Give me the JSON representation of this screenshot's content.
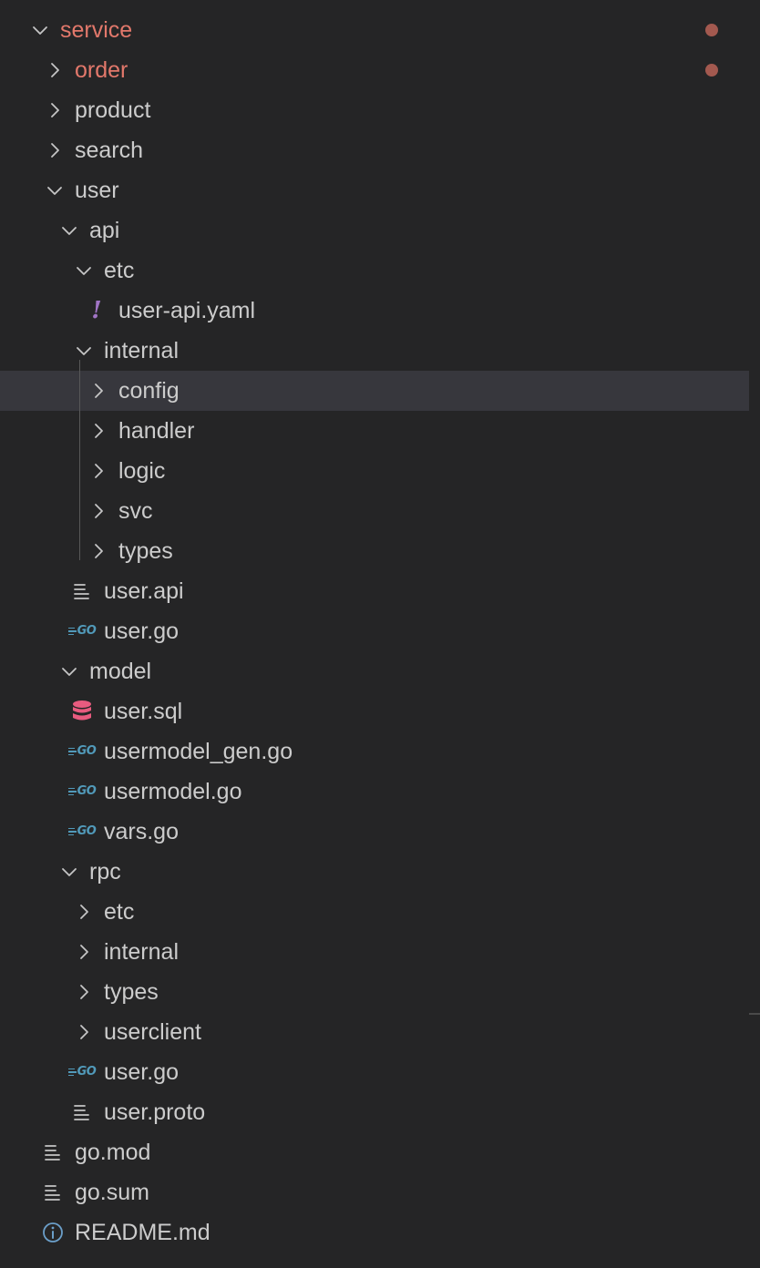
{
  "colors": {
    "background": "#252526",
    "text": "#cccccc",
    "modified": "#e2786b",
    "modified_dot": "#a3594f",
    "selection": "#37373d",
    "go_icon": "#519aba",
    "yaml_icon": "#a074c4",
    "sql_icon": "#e85b7f"
  },
  "explorer": {
    "items": [
      {
        "label": "service",
        "kind": "folder",
        "expanded": true,
        "depth": 0,
        "modified": true,
        "badge": true
      },
      {
        "label": "order",
        "kind": "folder",
        "expanded": false,
        "depth": 1,
        "modified": true,
        "badge": true
      },
      {
        "label": "product",
        "kind": "folder",
        "expanded": false,
        "depth": 1
      },
      {
        "label": "search",
        "kind": "folder",
        "expanded": false,
        "depth": 1
      },
      {
        "label": "user",
        "kind": "folder",
        "expanded": true,
        "depth": 1
      },
      {
        "label": "api",
        "kind": "folder",
        "expanded": true,
        "depth": 2
      },
      {
        "label": "etc",
        "kind": "folder",
        "expanded": true,
        "depth": 3
      },
      {
        "label": "user-api.yaml",
        "kind": "file",
        "icon": "yaml-icon",
        "depth": 4
      },
      {
        "label": "internal",
        "kind": "folder",
        "expanded": true,
        "depth": 3
      },
      {
        "label": "config",
        "kind": "folder",
        "expanded": false,
        "depth": 4,
        "selected": true
      },
      {
        "label": "handler",
        "kind": "folder",
        "expanded": false,
        "depth": 4
      },
      {
        "label": "logic",
        "kind": "folder",
        "expanded": false,
        "depth": 4
      },
      {
        "label": "svc",
        "kind": "folder",
        "expanded": false,
        "depth": 4
      },
      {
        "label": "types",
        "kind": "folder",
        "expanded": false,
        "depth": 4
      },
      {
        "label": "user.api",
        "kind": "file",
        "icon": "text-file-icon",
        "depth": 3
      },
      {
        "label": "user.go",
        "kind": "file",
        "icon": "go-icon",
        "depth": 3
      },
      {
        "label": "model",
        "kind": "folder",
        "expanded": true,
        "depth": 2
      },
      {
        "label": "user.sql",
        "kind": "file",
        "icon": "database-icon",
        "depth": 3
      },
      {
        "label": "usermodel_gen.go",
        "kind": "file",
        "icon": "go-icon",
        "depth": 3
      },
      {
        "label": "usermodel.go",
        "kind": "file",
        "icon": "go-icon",
        "depth": 3
      },
      {
        "label": "vars.go",
        "kind": "file",
        "icon": "go-icon",
        "depth": 3
      },
      {
        "label": "rpc",
        "kind": "folder",
        "expanded": true,
        "depth": 2
      },
      {
        "label": "etc",
        "kind": "folder",
        "expanded": false,
        "depth": 3
      },
      {
        "label": "internal",
        "kind": "folder",
        "expanded": false,
        "depth": 3
      },
      {
        "label": "types",
        "kind": "folder",
        "expanded": false,
        "depth": 3
      },
      {
        "label": "userclient",
        "kind": "folder",
        "expanded": false,
        "depth": 3
      },
      {
        "label": "user.go",
        "kind": "file",
        "icon": "go-icon",
        "depth": 3
      },
      {
        "label": "user.proto",
        "kind": "file",
        "icon": "text-file-icon",
        "depth": 3
      },
      {
        "label": "go.mod",
        "kind": "file",
        "icon": "text-file-icon",
        "depth": 1
      },
      {
        "label": "go.sum",
        "kind": "file",
        "icon": "text-file-icon",
        "depth": 1
      },
      {
        "label": "README.md",
        "kind": "file",
        "icon": "info-icon",
        "depth": 1
      }
    ]
  },
  "icon_text": {
    "go": "GO",
    "yaml": "!"
  }
}
